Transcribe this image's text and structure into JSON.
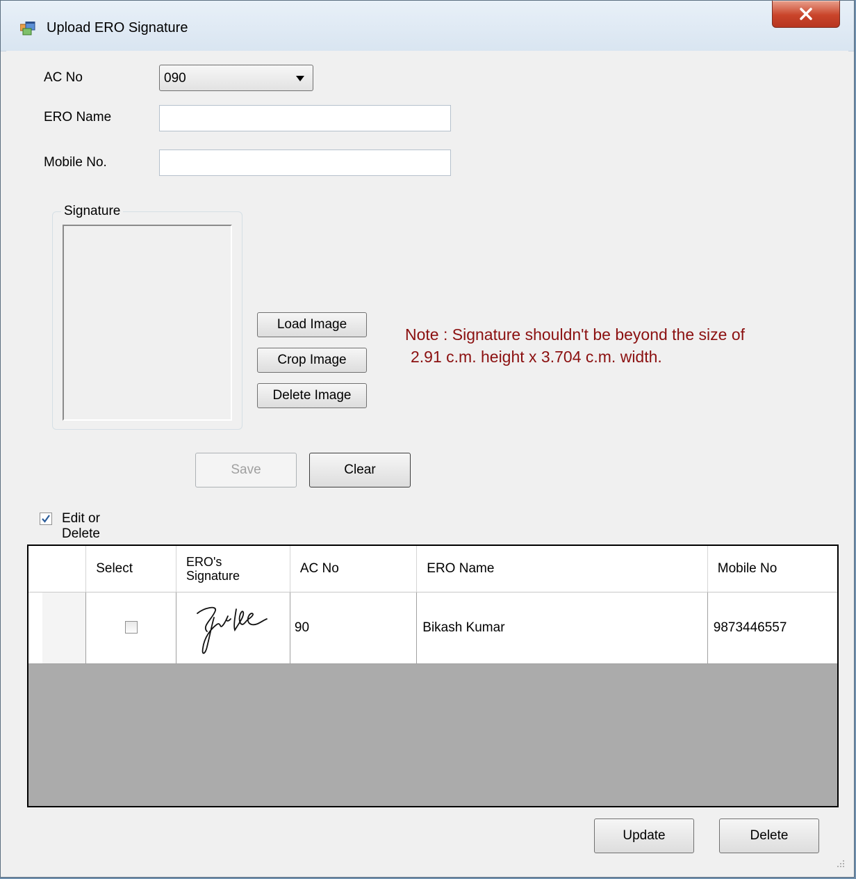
{
  "window": {
    "title": "Upload ERO Signature"
  },
  "form": {
    "ac_no_label": "AC No",
    "ac_no_value": "090",
    "ero_name_label": "ERO Name",
    "ero_name_value": "",
    "mobile_label": "Mobile No.",
    "mobile_value": ""
  },
  "signature": {
    "group_label": "Signature",
    "load_label": "Load Image",
    "crop_label": "Crop Image",
    "delete_label": "Delete Image"
  },
  "note": {
    "line1": "Note : Signature shouldn't be beyond the size of",
    "line2": "2.91 c.m. height x 3.704 c.m. width."
  },
  "actions": {
    "save_label": "Save",
    "clear_label": "Clear"
  },
  "edit_or_delete": {
    "label": "Edit or Delete",
    "checked": true
  },
  "grid": {
    "columns": [
      "Select",
      "ERO's Signature",
      "AC No",
      "ERO Name",
      "Mobile No"
    ],
    "column_signature_line1": "ERO's",
    "column_signature_line2": "Signature",
    "rows": [
      {
        "select": false,
        "ac_no": "90",
        "ero_name": "Bikash Kumar",
        "mobile_no": "9873446557"
      }
    ]
  },
  "footer": {
    "update_label": "Update",
    "delete_label": "Delete"
  }
}
